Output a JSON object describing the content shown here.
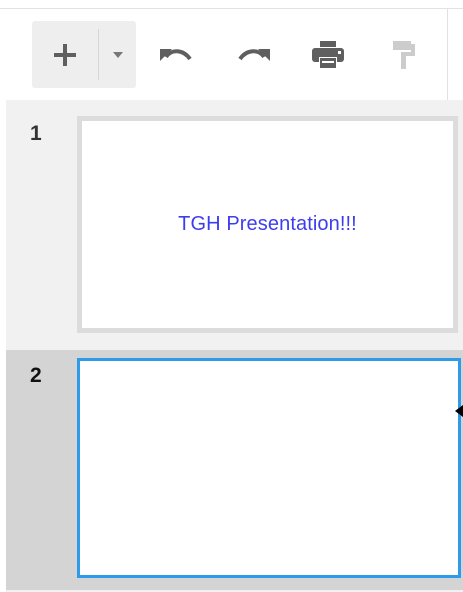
{
  "toolbar": {
    "new_slide": "new-slide",
    "new_slide_menu": "new-slide-layout-menu",
    "undo": "undo",
    "redo": "redo",
    "print": "print",
    "paint_format": "paint-format"
  },
  "slides": [
    {
      "number": "1",
      "title": "TGH Presentation!!!",
      "selected": false
    },
    {
      "number": "2",
      "title": "",
      "selected": true
    }
  ],
  "colors": {
    "selection_border": "#2d9bea",
    "title_text": "#3d3df0",
    "icon": "#5f5f5f",
    "icon_disabled": "#cccccc"
  }
}
